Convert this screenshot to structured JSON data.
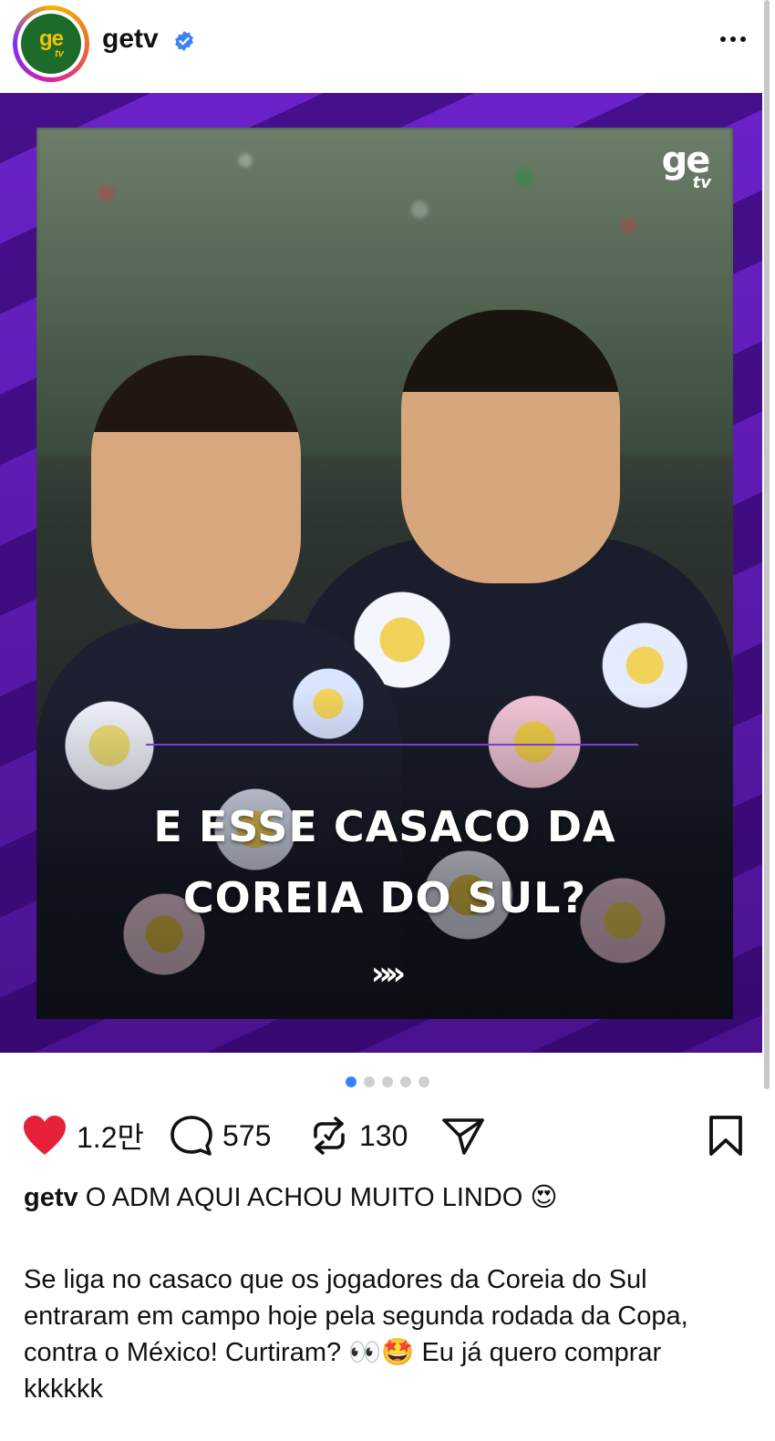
{
  "header": {
    "avatar_text": "ge",
    "avatar_subtext": "tv",
    "username": "getv",
    "verified": "verified-badge-icon",
    "more": "more-options-icon"
  },
  "post": {
    "image": {
      "logo_text": "ge",
      "logo_subtext": "tv",
      "headline_line1": "E ESSE CASACO DA",
      "headline_line2": "COREIA DO SUL?",
      "swipe_hint": "»»"
    },
    "carousel": {
      "count": 5,
      "active_index": 0
    }
  },
  "actions": {
    "likes": "1.2만",
    "comments": "575",
    "reposts": "130",
    "icons": [
      "heart-icon",
      "comment-icon",
      "repost-icon",
      "share-icon",
      "bookmark-icon"
    ],
    "like_color": "#e8213b"
  },
  "caption": {
    "username": "getv",
    "first_line": "O ADM AQUI ACHOU MUITO LINDO 😍",
    "body": "Se liga no casaco que os jogadores da Coreia do Sul entraram em campo hoje pela segunda rodada da Copa, contra o México! Curtiram? 👀🤩 Eu já quero comprar kkkkkk"
  },
  "colors": {
    "accent_blue": "#3b82f6",
    "brand_purple": "#6b22c9",
    "brand_green": "#1d6b2a",
    "brand_yellow": "#f4c300"
  }
}
